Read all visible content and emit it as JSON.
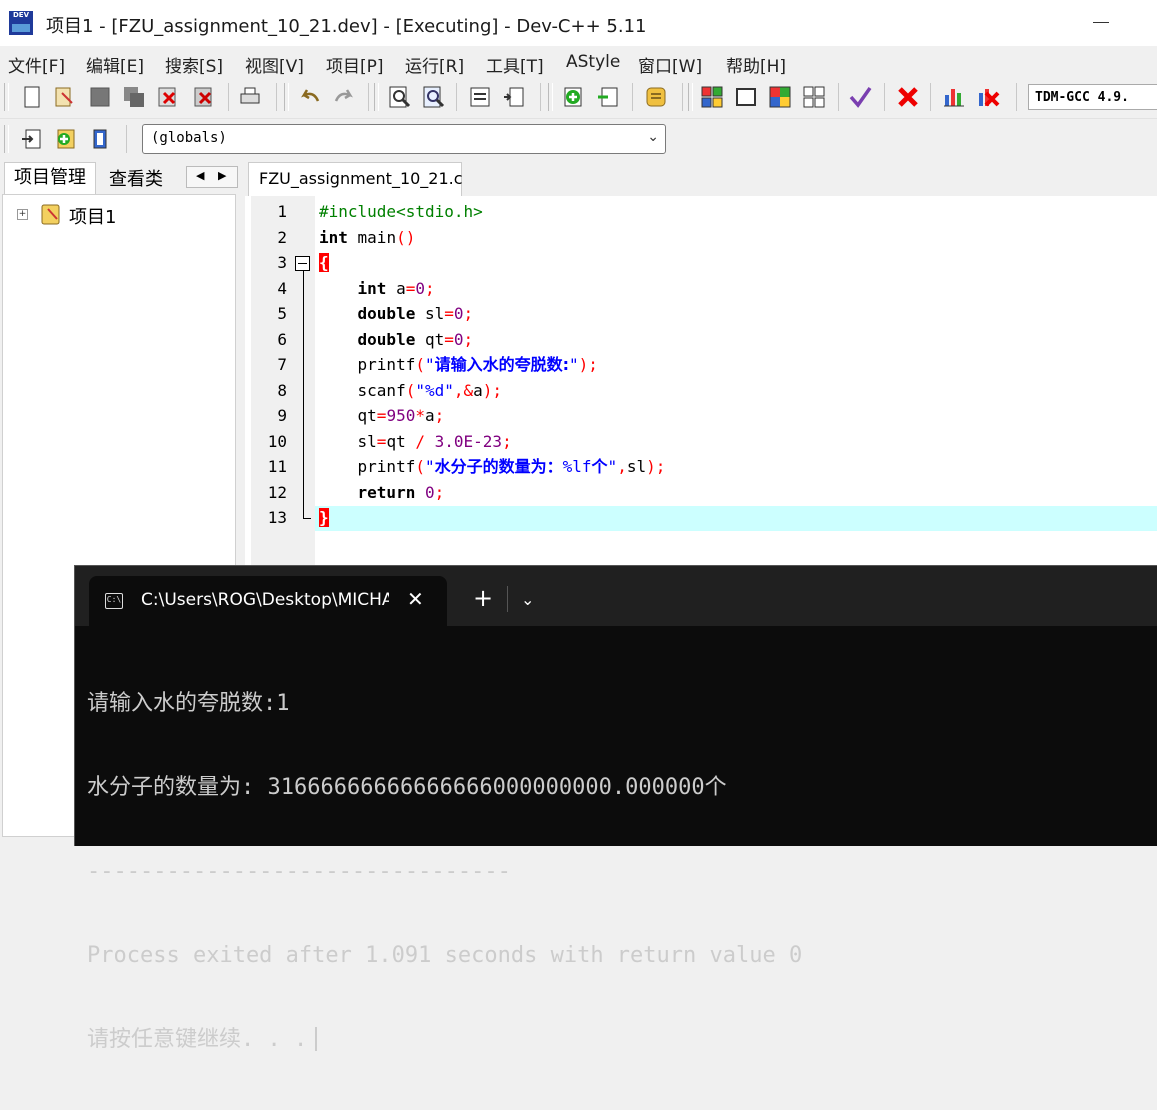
{
  "window": {
    "title": "项目1 - [FZU_assignment_10_21.dev] - [Executing] - Dev-C++ 5.11",
    "icon_text": "DEV"
  },
  "menu": [
    "文件[F]",
    "编辑[E]",
    "搜索[S]",
    "视图[V]",
    "项目[P]",
    "运行[R]",
    "工具[T]",
    "AStyle",
    "窗口[W]",
    "帮助[H]"
  ],
  "toolbar": {
    "compiler": "TDM-GCC 4.9.",
    "scope_select": "(globals)"
  },
  "left_panel": {
    "tabs": [
      "项目管理",
      "查看类"
    ],
    "tree_root": "项目1",
    "expander": "+"
  },
  "editor": {
    "tab_label": "FZU_assignment_10_21.c",
    "line_numbers": [
      "1",
      "2",
      "3",
      "4",
      "5",
      "6",
      "7",
      "8",
      "9",
      "10",
      "11",
      "12",
      "13"
    ],
    "current_line": 13
  },
  "terminal": {
    "tab_title": "C:\\Users\\ROG\\Desktop\\MICHA",
    "tab_close": "✕",
    "new_tab": "+",
    "dropdown": "⌄",
    "lines": [
      "请输入水的夸脱数:1",
      "水分子的数量为: 31666666666666666000000000.000000个",
      "--------------------------------",
      "Process exited after 1.091 seconds with return value 0",
      "请按任意键继续. . ."
    ]
  },
  "colors": {
    "preprocessor": "#008000",
    "operator": "#ff0000",
    "number": "#800080",
    "string": "#0000ff",
    "current_line": "#ccffff",
    "terminal_bg": "#0c0c0c"
  }
}
